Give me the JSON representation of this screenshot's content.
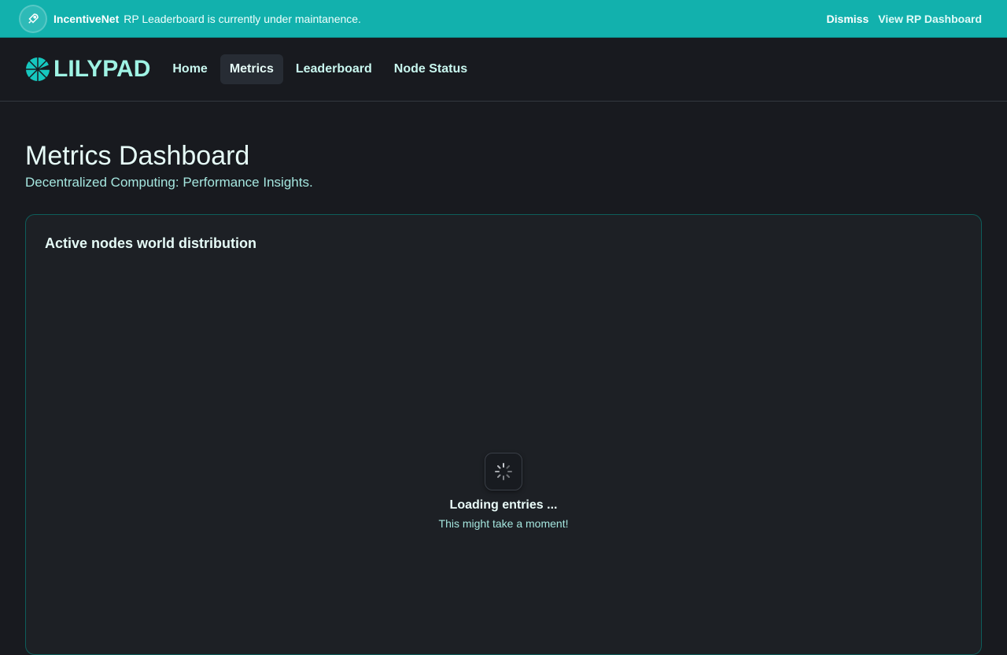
{
  "banner": {
    "tag": "IncentiveNet",
    "message": "RP Leaderboard is currently under maintanence.",
    "dismiss": "Dismiss",
    "view": "View RP Dashboard"
  },
  "nav": {
    "logo": "LILYPAD",
    "items": [
      "Home",
      "Metrics",
      "Leaderboard",
      "Node Status"
    ],
    "active": "Metrics"
  },
  "page": {
    "title": "Metrics Dashboard",
    "subtitle": "Decentralized Computing: Performance Insights."
  },
  "card": {
    "title": "Active nodes world distribution",
    "loading_title": "Loading entries ...",
    "loading_subtitle": "This might take a moment!"
  }
}
